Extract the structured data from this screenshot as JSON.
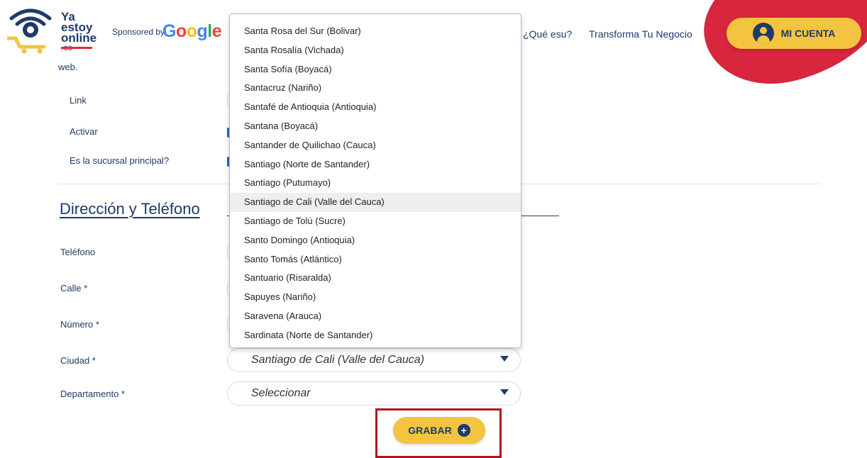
{
  "header": {
    "logo": {
      "line1": "Ya",
      "line2": "estoy",
      "line3": "online",
      "line4": ".co"
    },
    "sponsored_text": "Sponsored by",
    "google_letters": [
      {
        "ch": "G",
        "color": "#4285F4"
      },
      {
        "ch": "o",
        "color": "#EA4335"
      },
      {
        "ch": "o",
        "color": "#FBBC05"
      },
      {
        "ch": "g",
        "color": "#4285F4"
      },
      {
        "ch": "l",
        "color": "#34A853"
      },
      {
        "ch": "e",
        "color": "#EA4335"
      }
    ],
    "nav": {
      "que_es": "¿Qué esu?",
      "transforma": "Transforma Tu Negocio"
    },
    "account_button": "MI CUENTA"
  },
  "form": {
    "web_text": "web.",
    "labels": {
      "link": "Link",
      "activar": "Activar",
      "sucursal": "Es la sucursal principal?",
      "telefono": "Teléfono",
      "calle": "Calle *",
      "numero": "Número *",
      "ciudad": "Ciudad *",
      "departamento": "Departamento *"
    },
    "section_title": "Dirección y Teléfono",
    "ciudad_value": "Santiago de Cali (Valle del Cauca)",
    "departamento_value": "Seleccionar",
    "save_button": "GRABAR"
  },
  "dropdown": {
    "highlighted": "Santiago de Cali (Valle del Cauca)",
    "options": [
      "Santa Rosa del Sur (Bolivar)",
      "Santa Rosalía (Vichada)",
      "Santa Sofía (Boyacá)",
      "Santacruz (Nariño)",
      "Santafé de Antioquia (Antioquia)",
      "Santana (Boyacá)",
      "Santander de Quilichao (Cauca)",
      "Santiago (Norte de Santander)",
      "Santiago (Putumayo)",
      "Santiago de Cali (Valle del Cauca)",
      "Santiago de Tolú (Sucre)",
      "Santo Domingo (Antioquia)",
      "Santo Tomás (Atlántico)",
      "Santuario (Risaralda)",
      "Sapuyes (Nariño)",
      "Saravena (Arauca)",
      "Sardinata (Norte de Santander)"
    ]
  },
  "colors": {
    "brand_navy": "#1f3a6b",
    "brand_yellow": "#f3c43f",
    "brand_red": "#d7263d",
    "highlight_box": "#b3121f"
  }
}
